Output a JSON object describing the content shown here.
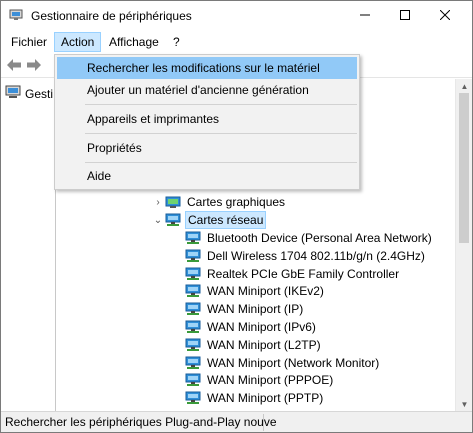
{
  "window": {
    "title": "Gestionnaire de périphériques",
    "controls": {
      "minimize": "minimize-icon",
      "maximize": "maximize-icon",
      "close": "close-icon"
    }
  },
  "menubar": {
    "items": [
      {
        "label": "Fichier"
      },
      {
        "label": "Action",
        "active": true
      },
      {
        "label": "Affichage"
      },
      {
        "label": "?"
      }
    ]
  },
  "toolbar": {
    "back_icon": "back-arrow-icon",
    "forward_icon": "forward-arrow-icon"
  },
  "left_pane": {
    "root_label": "Gesti"
  },
  "action_menu": {
    "items": [
      {
        "label": "Rechercher les modifications sur le matériel",
        "highlighted": true
      },
      {
        "label": "Ajouter un matériel d'ancienne génération"
      },
      {
        "label": "Appareils et imprimantes"
      },
      {
        "label": "Propriétés"
      },
      {
        "label": "Aide"
      }
    ]
  },
  "tree": {
    "categories": [
      {
        "label": "Cartes graphiques",
        "expanded": false
      },
      {
        "label": "Cartes réseau",
        "expanded": true,
        "selected": true
      }
    ],
    "network_adapters": [
      "Bluetooth Device (Personal Area Network)",
      "Dell Wireless 1704 802.11b/g/n (2.4GHz)",
      "Realtek PCIe GbE Family Controller",
      "WAN Miniport (IKEv2)",
      "WAN Miniport (IP)",
      "WAN Miniport (IPv6)",
      "WAN Miniport (L2TP)",
      "WAN Miniport (Network Monitor)",
      "WAN Miniport (PPPOE)",
      "WAN Miniport (PPTP)"
    ]
  },
  "statusbar": {
    "text": "Rechercher les périphériques Plug-and-Play nouve"
  },
  "colors": {
    "menu_highlight": "#91c9f7",
    "selection": "#cce8ff",
    "network_icon": "#1e90d6"
  }
}
